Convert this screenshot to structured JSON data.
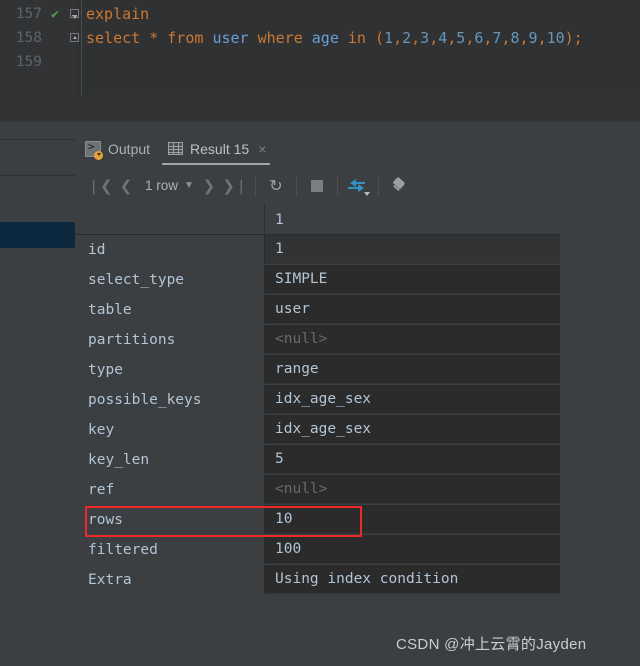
{
  "editor": {
    "lines": [
      {
        "number": "157",
        "has_run_marker": true,
        "fold": "down",
        "tokens": [
          {
            "text": "explain",
            "type": "kw"
          }
        ]
      },
      {
        "number": "158",
        "has_run_marker": false,
        "fold": "up",
        "tokens": [
          {
            "text": "select",
            "type": "kw"
          },
          {
            "text": " ",
            "type": "plain"
          },
          {
            "text": "*",
            "type": "punct"
          },
          {
            "text": " ",
            "type": "plain"
          },
          {
            "text": "from",
            "type": "kw"
          },
          {
            "text": " ",
            "type": "plain"
          },
          {
            "text": "user",
            "type": "id2"
          },
          {
            "text": " ",
            "type": "plain"
          },
          {
            "text": "where",
            "type": "kw"
          },
          {
            "text": " ",
            "type": "plain"
          },
          {
            "text": "age",
            "type": "id2"
          },
          {
            "text": " ",
            "type": "plain"
          },
          {
            "text": "in",
            "type": "kw"
          },
          {
            "text": " (",
            "type": "punct"
          },
          {
            "text": "1",
            "type": "num"
          },
          {
            "text": ",",
            "type": "punct"
          },
          {
            "text": "2",
            "type": "num"
          },
          {
            "text": ",",
            "type": "punct"
          },
          {
            "text": "3",
            "type": "num"
          },
          {
            "text": ",",
            "type": "punct"
          },
          {
            "text": "4",
            "type": "num"
          },
          {
            "text": ",",
            "type": "punct"
          },
          {
            "text": "5",
            "type": "num"
          },
          {
            "text": ",",
            "type": "punct"
          },
          {
            "text": "6",
            "type": "num"
          },
          {
            "text": ",",
            "type": "punct"
          },
          {
            "text": "7",
            "type": "num"
          },
          {
            "text": ",",
            "type": "punct"
          },
          {
            "text": "8",
            "type": "num"
          },
          {
            "text": ",",
            "type": "punct"
          },
          {
            "text": "9",
            "type": "num"
          },
          {
            "text": ",",
            "type": "punct"
          },
          {
            "text": "10",
            "type": "num"
          },
          {
            "text": ");",
            "type": "punct"
          }
        ]
      },
      {
        "number": "159",
        "has_run_marker": false,
        "fold": "none",
        "tokens": []
      }
    ],
    "run_marker_glyph": "✔"
  },
  "tabs": [
    {
      "id": "output",
      "label": "Output",
      "icon": "console-icon",
      "active": false,
      "closable": false
    },
    {
      "id": "result",
      "label": "Result 15",
      "icon": "grid-icon",
      "active": true,
      "closable": true,
      "close_glyph": "×"
    }
  ],
  "toolbar": {
    "first_page_glyph": "❘❮",
    "prev_page_glyph": "❮",
    "row_count_label": "1 row",
    "row_count_caret": "▼",
    "next_page_glyph": "❯",
    "last_page_glyph": "❯❘",
    "refresh_glyph": "↻",
    "buttons": {
      "first_page": "first-page-button",
      "prev_page": "previous-page-button",
      "row_count": "row-count-dropdown",
      "next_page": "next-page-button",
      "last_page": "last-page-button",
      "reload": "reload-button",
      "stop": "stop-button",
      "transpose": "transpose-button",
      "pin": "pin-tab-button"
    }
  },
  "result_grid": {
    "column_header": "1",
    "row_header_blank": "",
    "rows": [
      {
        "name": "id",
        "value": "1",
        "is_null": false
      },
      {
        "name": "select_type",
        "value": "SIMPLE",
        "is_null": false
      },
      {
        "name": "table",
        "value": "user",
        "is_null": false
      },
      {
        "name": "partitions",
        "value": "<null>",
        "is_null": true
      },
      {
        "name": "type",
        "value": "range",
        "is_null": false
      },
      {
        "name": "possible_keys",
        "value": "idx_age_sex",
        "is_null": false
      },
      {
        "name": "key",
        "value": "idx_age_sex",
        "is_null": false
      },
      {
        "name": "key_len",
        "value": "5",
        "is_null": false
      },
      {
        "name": "ref",
        "value": "<null>",
        "is_null": true
      },
      {
        "name": "rows",
        "value": "10",
        "is_null": false,
        "highlighted": true
      },
      {
        "name": "filtered",
        "value": "100",
        "is_null": false
      },
      {
        "name": "Extra",
        "value": "Using index condition",
        "is_null": false
      }
    ]
  },
  "annotation": {
    "highlight_row_name": "rows",
    "highlight_color": "#ec2a2a"
  },
  "watermark": {
    "text": "CSDN @冲上云霄的Jayden"
  },
  "colors": {
    "editor_bg": "#2f3133",
    "gutter_bg": "#313335",
    "panel_bg": "#3c3f41",
    "grid_bg": "#2b2b2b",
    "keyword": "#cc7832",
    "identifier": "#6a9fd4",
    "number": "#6897bb",
    "text": "#b2c5d6",
    "null_text": "#6a6a6a",
    "selection_blue": "#0d293f",
    "accent_blue": "#3592c4",
    "run_green": "#499c54"
  }
}
